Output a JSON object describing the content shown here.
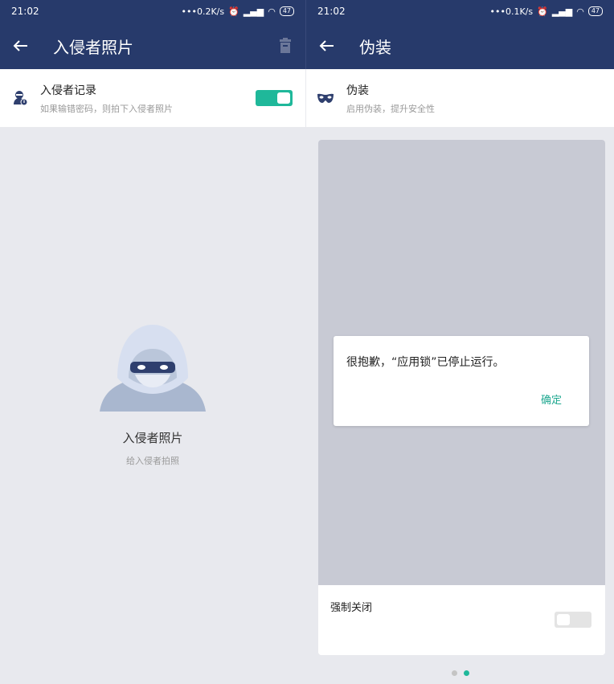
{
  "left": {
    "status": {
      "time": "21:02",
      "speed": "0.2K/s",
      "battery": "47"
    },
    "appbar": {
      "title": "入侵者照片"
    },
    "setting": {
      "title": "入侵者记录",
      "subtitle": "如果输错密码，则拍下入侵者照片",
      "enabled": true
    },
    "empty": {
      "title": "入侵者照片",
      "subtitle": "给入侵者拍照"
    }
  },
  "right": {
    "status": {
      "time": "21:02",
      "speed": "0.1K/s",
      "battery": "47"
    },
    "appbar": {
      "title": "伪装"
    },
    "setting": {
      "title": "伪装",
      "subtitle": "启用伪装，提升安全性"
    },
    "dialog": {
      "message": "很抱歉，“应用锁”已停止运行。",
      "ok_label": "确定"
    },
    "force": {
      "label": "强制关闭",
      "enabled": false
    },
    "pager": {
      "count": 2,
      "active": 2
    }
  },
  "colors": {
    "appbar": "#273a6b",
    "accent": "#1fb89a",
    "background": "#e8e9ee"
  },
  "icons": [
    "back-arrow-icon",
    "trash-icon",
    "intruder-icon",
    "mask-icon",
    "hacker-illustration"
  ]
}
